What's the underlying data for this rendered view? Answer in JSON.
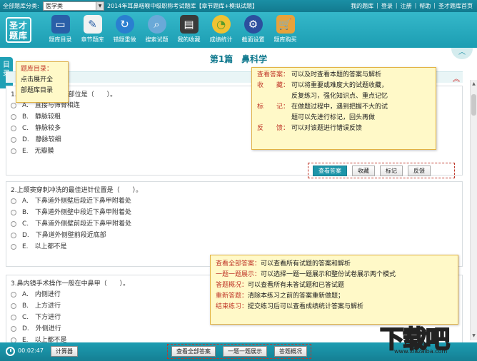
{
  "topbar": {
    "category_label": "全部题库分类:",
    "category_value": "医学类",
    "title": "2014年耳鼻咽喉中级职称考试题库【章节题库+模拟试题】",
    "links": [
      "我的题库",
      "登录",
      "注册",
      "帮助",
      "圣才题库首页"
    ]
  },
  "logo": {
    "line1": "圣才",
    "line2": "题库"
  },
  "toolbar": {
    "items": [
      {
        "label": "题库目录",
        "icon": "monitor-icon",
        "color": "#2a5fa8"
      },
      {
        "label": "章节题库",
        "icon": "notepad-icon",
        "color": "#f2f2f2"
      },
      {
        "label": "错题重做",
        "icon": "refresh-icon",
        "color": "#2a7fd0"
      },
      {
        "label": "搜索试题",
        "icon": "search-icon",
        "color": "#6aa9d8"
      },
      {
        "label": "我的收藏",
        "icon": "folder-icon",
        "color": "#3a3a3a"
      },
      {
        "label": "成绩统计",
        "icon": "chart-icon",
        "color": "#f1c232"
      },
      {
        "label": "截面设置",
        "icon": "gear-icon",
        "color": "#2c4f9e"
      },
      {
        "label": "题库购买",
        "icon": "cart-icon",
        "color": "#e8a23a"
      }
    ]
  },
  "sidetab": "目录",
  "section_title": "第1篇　鼻科学",
  "questions": [
    {
      "stem": "1.下鼻甲的骨性附着部位是（　　）。",
      "options": [
        "A.　直接与筛骨相连",
        "B.　静脉较粗",
        "C.　静脉较多",
        "D.　静脉较细",
        "E.　无瓣膜"
      ]
    },
    {
      "stem": "2.上颌窦穿刺冲洗的最佳进针位置是（　　）。",
      "options": [
        "A.　下鼻道外侧壁后段近下鼻甲附着处",
        "B.　下鼻道外侧壁中段近下鼻甲附着处",
        "C.　下鼻道外侧壁前段近下鼻甲附着处",
        "D.　下鼻道外侧壁前段近底部",
        "E.　以上都不是"
      ]
    },
    {
      "stem": "3.鼻内镜手术操作一般在中鼻甲（　　）。",
      "options": [
        "A.　内侧进行",
        "B.　上方进行",
        "C.　下方进行",
        "D.　外侧进行",
        "E.　以上都不是"
      ]
    }
  ],
  "actions": {
    "show_answer": "查看答案",
    "favorite": "收藏",
    "mark": "标记",
    "feedback": "反馈"
  },
  "tip_catalog": {
    "line1": "题库目录：",
    "line2": "点击展开全",
    "line3": "部题库目录"
  },
  "tip_actions": [
    {
      "key": "查看答案：",
      "text": "可以及时查看本题的答案与解析"
    },
    {
      "key": "收　　藏：",
      "text": "可以将重要或难度大的试题收藏，"
    },
    {
      "key": "",
      "text": "反复练习，强化知识点、重点记忆"
    },
    {
      "key": "标　　记：",
      "text": "在做题过程中，遇到把握不大的试"
    },
    {
      "key": "",
      "text": "题可以先进行标记，回头再做"
    },
    {
      "key": "反　　馈：",
      "text": "可以对该题进行错误反馈"
    }
  ],
  "tip_bottom": [
    {
      "key": "查看全部答案：",
      "text": "可以查看所有试题的答案和解析"
    },
    {
      "key": "一题一题展示：",
      "text": "可以选择一题一题展示和整份试卷展示两个模式"
    },
    {
      "key": "答题概况：",
      "text": "可以查看所有未答试题和已答试题"
    },
    {
      "key": "重新答题：",
      "text": "清除本练习之前的答案重新做题；"
    },
    {
      "key": "结束练习：",
      "text": "提交练习后可以查看成绩统计答案与解析"
    }
  ],
  "bottom": {
    "timer": "00:02:47",
    "calculator": "计算器",
    "show_all": "查看全部答案",
    "one_by_one": "一题一题展示",
    "overview": "答题概况"
  },
  "watermark": {
    "big": "下载吧",
    "small": "www.xiazaiba.com"
  }
}
